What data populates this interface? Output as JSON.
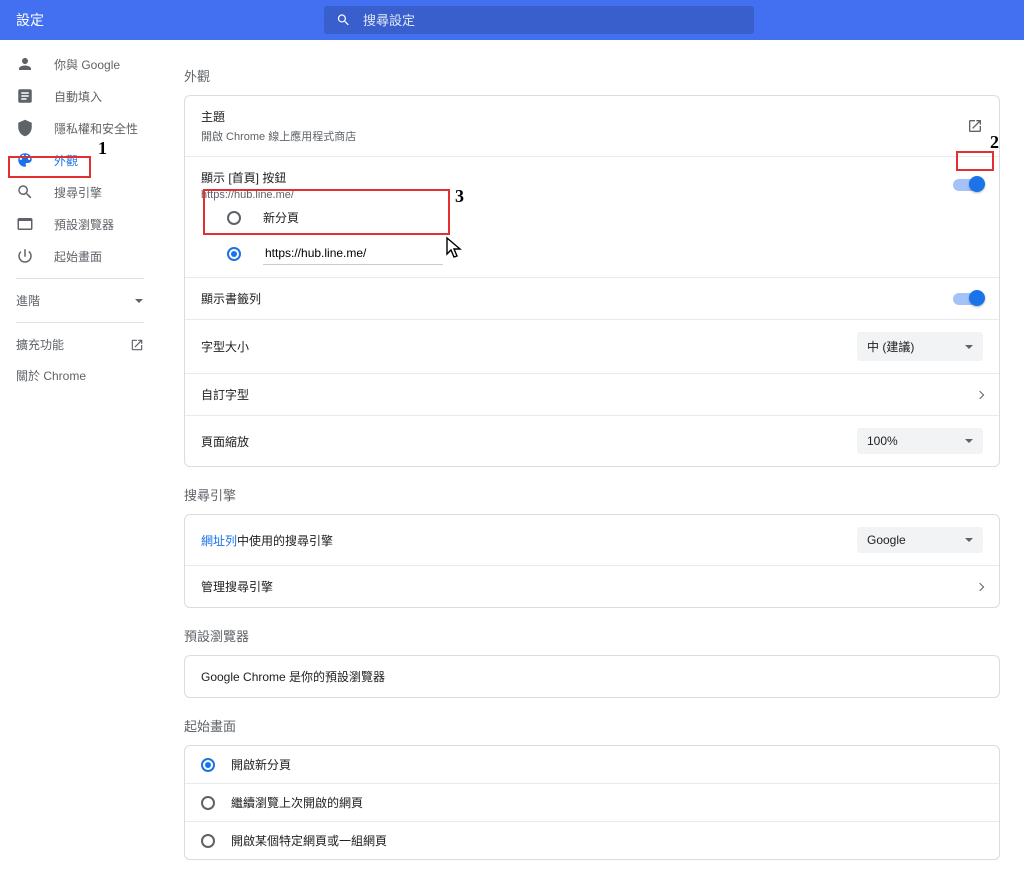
{
  "header": {
    "title": "設定",
    "search_placeholder": "搜尋設定"
  },
  "sidebar": {
    "items": [
      {
        "label": "你與 Google"
      },
      {
        "label": "自動填入"
      },
      {
        "label": "隱私權和安全性"
      },
      {
        "label": "外觀"
      },
      {
        "label": "搜尋引擎"
      },
      {
        "label": "預設瀏覽器"
      },
      {
        "label": "起始畫面"
      }
    ],
    "advanced": "進階",
    "extensions": "擴充功能",
    "about": "關於 Chrome"
  },
  "appearance": {
    "section_title": "外觀",
    "theme_title": "主題",
    "theme_sub": "開啟 Chrome 線上應用程式商店",
    "home_button_label": "顯示 [首頁] 按鈕",
    "home_button_sub": "https://hub.line.me/",
    "new_tab_option": "新分頁",
    "custom_url_value": "https://hub.line.me/",
    "bookmarks_bar": "顯示書籤列",
    "font_size": "字型大小",
    "font_size_value": "中 (建議)",
    "custom_font": "自訂字型",
    "page_zoom": "頁面縮放",
    "page_zoom_value": "100%"
  },
  "search_engine": {
    "section_title": "搜尋引擎",
    "address_bar_prefix": "網址列",
    "address_bar_suffix": "中使用的搜尋引擎",
    "engine_value": "Google",
    "manage": "管理搜尋引擎"
  },
  "default_browser": {
    "section_title": "預設瀏覽器",
    "status": "Google Chrome 是你的預設瀏覽器"
  },
  "startup": {
    "section_title": "起始畫面",
    "option1": "開啟新分頁",
    "option2": "繼續瀏覽上次開啟的網頁",
    "option3": "開啟某個特定網頁或一組網頁"
  },
  "annotations": {
    "a1": "1",
    "a2": "2",
    "a3": "3"
  }
}
